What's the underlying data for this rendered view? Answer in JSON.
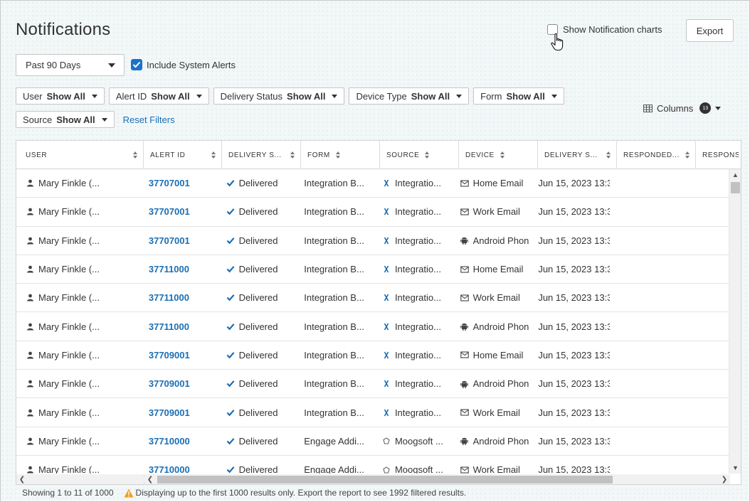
{
  "page": {
    "title": "Notifications"
  },
  "toolbar": {
    "show_charts_label": "Show Notification charts",
    "export_label": "Export"
  },
  "range": {
    "value": "Past 90 Days"
  },
  "system_alerts": {
    "label": "Include System Alerts",
    "checked": true
  },
  "filters": [
    {
      "name": "User",
      "value": "Show All"
    },
    {
      "name": "Alert ID",
      "value": "Show All"
    },
    {
      "name": "Delivery Status",
      "value": "Show All"
    },
    {
      "name": "Device Type",
      "value": "Show All"
    },
    {
      "name": "Form",
      "value": "Show All"
    },
    {
      "name": "Source",
      "value": "Show All"
    }
  ],
  "reset_filters_label": "Reset Filters",
  "columns_ctrl": {
    "label": "Columns",
    "count": "13"
  },
  "table": {
    "headers": [
      "USER",
      "ALERT ID",
      "DELIVERY S...",
      "FORM",
      "SOURCE",
      "DEVICE",
      "DELIVERY S...",
      "RESPONDED...",
      "RESPONSI"
    ],
    "rows": [
      {
        "user": "Mary Finkle (...",
        "alert_id": "37707001",
        "status": "Delivered",
        "form": "Integration B...",
        "source": "Integratio...",
        "source_icon": "integration-icon",
        "device": "Home Email",
        "device_icon": "email-icon",
        "delivered": "Jun 15, 2023 13:3",
        "responded": "",
        "response": ""
      },
      {
        "user": "Mary Finkle (...",
        "alert_id": "37707001",
        "status": "Delivered",
        "form": "Integration B...",
        "source": "Integratio...",
        "source_icon": "integration-icon",
        "device": "Work Email",
        "device_icon": "email-icon",
        "delivered": "Jun 15, 2023 13:3",
        "responded": "",
        "response": ""
      },
      {
        "user": "Mary Finkle (...",
        "alert_id": "37707001",
        "status": "Delivered",
        "form": "Integration B...",
        "source": "Integratio...",
        "source_icon": "integration-icon",
        "device": "Android Phon",
        "device_icon": "android-icon",
        "delivered": "Jun 15, 2023 13:3",
        "responded": "",
        "response": ""
      },
      {
        "user": "Mary Finkle (...",
        "alert_id": "37711000",
        "status": "Delivered",
        "form": "Integration B...",
        "source": "Integratio...",
        "source_icon": "integration-icon",
        "device": "Home Email",
        "device_icon": "email-icon",
        "delivered": "Jun 15, 2023 13:3",
        "responded": "",
        "response": ""
      },
      {
        "user": "Mary Finkle (...",
        "alert_id": "37711000",
        "status": "Delivered",
        "form": "Integration B...",
        "source": "Integratio...",
        "source_icon": "integration-icon",
        "device": "Work Email",
        "device_icon": "email-icon",
        "delivered": "Jun 15, 2023 13:3",
        "responded": "",
        "response": ""
      },
      {
        "user": "Mary Finkle (...",
        "alert_id": "37711000",
        "status": "Delivered",
        "form": "Integration B...",
        "source": "Integratio...",
        "source_icon": "integration-icon",
        "device": "Android Phon",
        "device_icon": "android-icon",
        "delivered": "Jun 15, 2023 13:3",
        "responded": "",
        "response": ""
      },
      {
        "user": "Mary Finkle (...",
        "alert_id": "37709001",
        "status": "Delivered",
        "form": "Integration B...",
        "source": "Integratio...",
        "source_icon": "integration-icon",
        "device": "Home Email",
        "device_icon": "email-icon",
        "delivered": "Jun 15, 2023 13:3",
        "responded": "",
        "response": ""
      },
      {
        "user": "Mary Finkle (...",
        "alert_id": "37709001",
        "status": "Delivered",
        "form": "Integration B...",
        "source": "Integratio...",
        "source_icon": "integration-icon",
        "device": "Android Phon",
        "device_icon": "android-icon",
        "delivered": "Jun 15, 2023 13:3",
        "responded": "",
        "response": ""
      },
      {
        "user": "Mary Finkle (...",
        "alert_id": "37709001",
        "status": "Delivered",
        "form": "Integration B...",
        "source": "Integratio...",
        "source_icon": "integration-icon",
        "device": "Work Email",
        "device_icon": "email-icon",
        "delivered": "Jun 15, 2023 13:3",
        "responded": "",
        "response": ""
      },
      {
        "user": "Mary Finkle (...",
        "alert_id": "37710000",
        "status": "Delivered",
        "form": "Engage Addi...",
        "source": "Moogsoft ...",
        "source_icon": "moogsoft-icon",
        "device": "Android Phon",
        "device_icon": "android-icon",
        "delivered": "Jun 15, 2023 13:3",
        "responded": "",
        "response": ""
      },
      {
        "user": "Mary Finkle (...",
        "alert_id": "37710000",
        "status": "Delivered",
        "form": "Engage Addi...",
        "source": "Moogsoft ...",
        "source_icon": "moogsoft-icon",
        "device": "Work Email",
        "device_icon": "email-icon",
        "delivered": "Jun 15, 2023 13:3",
        "responded": "",
        "response": ""
      }
    ]
  },
  "footer": {
    "showing": "Showing 1 to 11 of 1000",
    "warning": "Displaying up to the first 1000 results only. Export the report to see 1992 filtered results."
  },
  "colors": {
    "accent": "#1a73c9",
    "link": "#1a6fb5",
    "warning": "#f0a020"
  }
}
